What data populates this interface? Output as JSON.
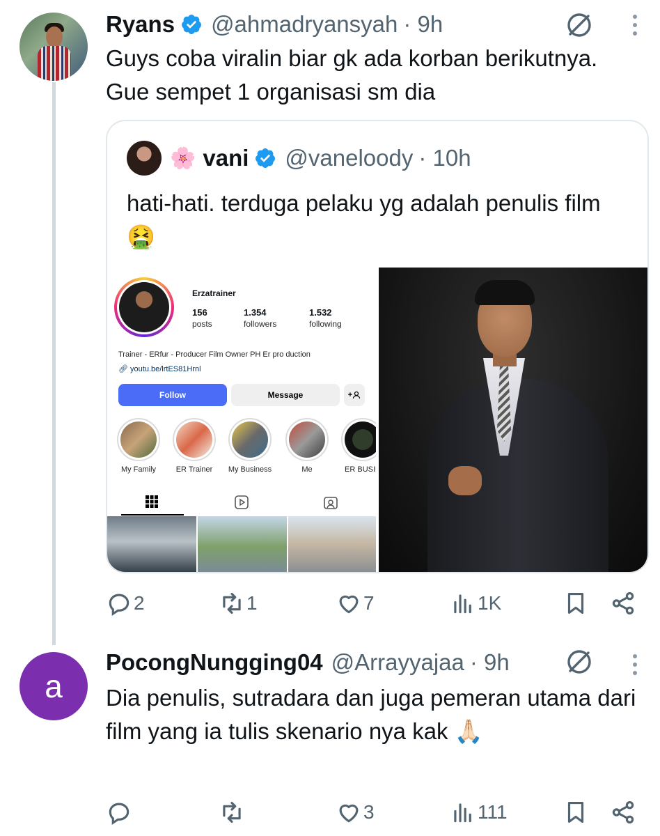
{
  "colors": {
    "accent": "#1d9bf0",
    "secondary_text": "#536471",
    "thread_line": "#cfd9de",
    "avatar_purple": "#7b2fae",
    "ig_follow": "#4a6cf7"
  },
  "tweet1": {
    "name": "Ryans",
    "handle": "@ahmadryansyah",
    "time": "· 9h",
    "text": "Guys coba viralin biar gk ada korban berikutnya. Gue sempet 1 organisasi sm dia",
    "quote": {
      "name": "vani",
      "handle": "@vaneloody",
      "time": "· 10h",
      "text": "hati-hati. terduga pelaku yg adalah penulis film 🤮",
      "instagram": {
        "username": "Erzatrainer",
        "posts": "156",
        "posts_label": "posts",
        "followers": "1.354",
        "followers_label": "followers",
        "following": "1.532",
        "following_label": "following",
        "bio": "Trainer - ERfur - Producer Film Owner PH Er pro duction",
        "link": "youtu.be/lrtES81Hrnl",
        "follow_label": "Follow",
        "message_label": "Message",
        "add_label": "+",
        "highlights": [
          "My Family",
          "ER Trainer",
          "My Business",
          "Me",
          "ER BUSIN"
        ]
      }
    },
    "actions": {
      "replies": "2",
      "reposts": "1",
      "likes": "7",
      "views": "1K"
    }
  },
  "tweet2": {
    "avatar_letter": "a",
    "name": "PocongNungging04",
    "handle": "@Arrayyajaa",
    "time": "· 9h",
    "text": "Dia penulis, sutradara dan juga pemeran utama dari film yang ia tulis skenario nya kak 🙏🏻",
    "actions": {
      "replies": "",
      "reposts": "",
      "likes": "3",
      "views": "111"
    }
  }
}
